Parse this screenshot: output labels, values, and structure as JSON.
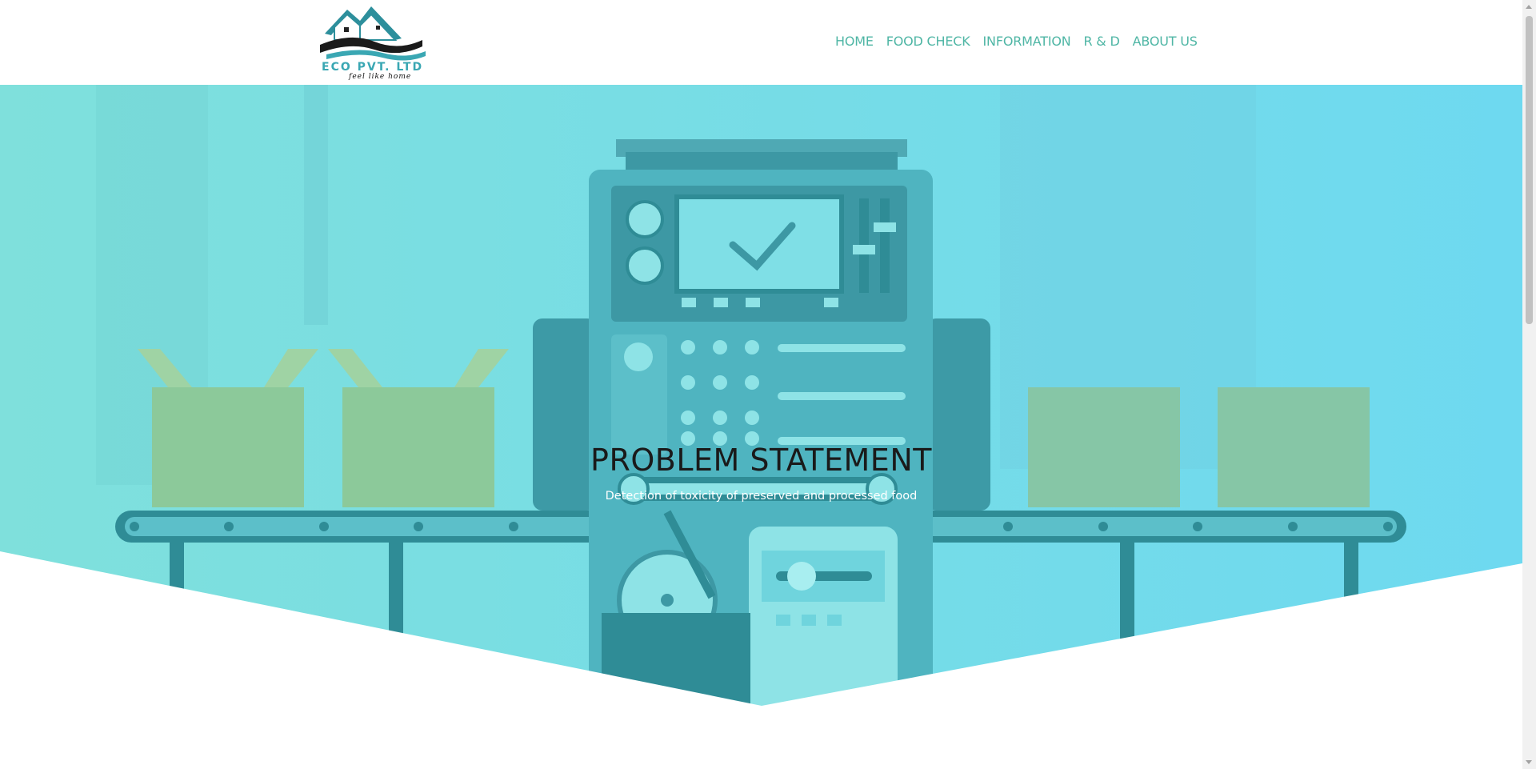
{
  "brand": {
    "name": "ECO PVT. LTD",
    "tagline": "feel like home"
  },
  "nav": {
    "items": [
      "HOME",
      "FOOD CHECK",
      "INFORMATION",
      "R & D",
      "ABOUT US"
    ]
  },
  "hero": {
    "title": "PROBLEM STATEMENT",
    "subtitle": "Detection of toxicity of preserved and processed food"
  },
  "colors": {
    "nav_text": "#4fb6a5",
    "hero_overlay_start": "#7fe0dc",
    "hero_overlay_end": "#6ed9f0",
    "machine": "#4fb4c0",
    "boxes": "#8cc99a"
  }
}
